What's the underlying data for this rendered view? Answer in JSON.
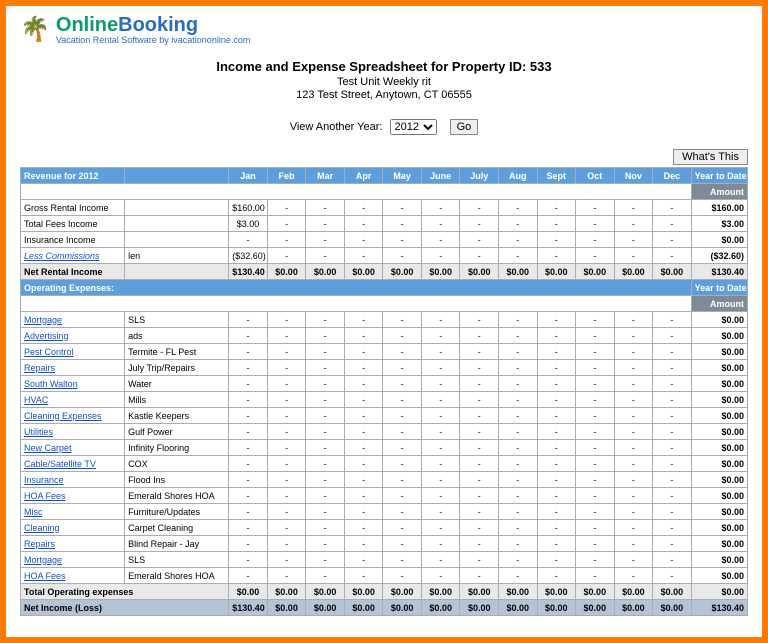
{
  "logo": {
    "online": "Online",
    "booking": "Booking",
    "tagline": "Vacation Rental Software by ivacationonline.com"
  },
  "title": {
    "main": "Income and Expense Spreadsheet for Property ID: 533",
    "unit": "Test Unit Weekly rit",
    "addr": "123 Test Street, Anytown, CT 06555"
  },
  "yearRow": {
    "label": "View Another Year:",
    "selected": "2012",
    "go": "Go"
  },
  "whatsThis": "What's This",
  "months": [
    "Jan",
    "Feb",
    "Mar",
    "Apr",
    "May",
    "June",
    "July",
    "Aug",
    "Sept",
    "Oct",
    "Nov",
    "Dec"
  ],
  "revHdr": "Revenue for 2012",
  "ytdHdr": "Year to Date",
  "amountHdr": "Amount",
  "revenue": [
    {
      "label": "Gross Rental Income",
      "sub": "",
      "vals": [
        "$160.00",
        "-",
        "-",
        "-",
        "-",
        "-",
        "-",
        "-",
        "-",
        "-",
        "-",
        "-"
      ],
      "ytd": "$160.00"
    },
    {
      "label": "Total Fees Income",
      "sub": "",
      "vals": [
        "$3.00",
        "-",
        "-",
        "-",
        "-",
        "-",
        "-",
        "-",
        "-",
        "-",
        "-",
        "-"
      ],
      "ytd": "$3.00"
    },
    {
      "label": "Insurance Income",
      "sub": "",
      "vals": [
        "-",
        "-",
        "-",
        "-",
        "-",
        "-",
        "-",
        "-",
        "-",
        "-",
        "-",
        "-"
      ],
      "ytd": "$0.00"
    },
    {
      "label": "Less Commissions",
      "sub": "len",
      "italic": true,
      "vals": [
        "($32.60)",
        "-",
        "-",
        "-",
        "-",
        "-",
        "-",
        "-",
        "-",
        "-",
        "-",
        "-"
      ],
      "ytd": "($32.60)"
    },
    {
      "label": "Net Rental Income",
      "sub": "",
      "total": true,
      "vals": [
        "$130.40",
        "$0.00",
        "$0.00",
        "$0.00",
        "$0.00",
        "$0.00",
        "$0.00",
        "$0.00",
        "$0.00",
        "$0.00",
        "$0.00",
        "$0.00"
      ],
      "ytd": "$130.40"
    }
  ],
  "opHdr": "Operating Expenses:",
  "expenses": [
    {
      "label": "Mortgage",
      "sub": "SLS",
      "vals": [
        "-",
        "-",
        "-",
        "-",
        "-",
        "-",
        "-",
        "-",
        "-",
        "-",
        "-",
        "-"
      ],
      "ytd": "$0.00"
    },
    {
      "label": "Advertising",
      "sub": "ads",
      "vals": [
        "-",
        "-",
        "-",
        "-",
        "-",
        "-",
        "-",
        "-",
        "-",
        "-",
        "-",
        "-"
      ],
      "ytd": "$0.00"
    },
    {
      "label": "Pest Control",
      "sub": "Termite - FL Pest",
      "vals": [
        "-",
        "-",
        "-",
        "-",
        "-",
        "-",
        "-",
        "-",
        "-",
        "-",
        "-",
        "-"
      ],
      "ytd": "$0.00"
    },
    {
      "label": "Repairs",
      "sub": "July Trip/Repairs",
      "vals": [
        "-",
        "-",
        "-",
        "-",
        "-",
        "-",
        "-",
        "-",
        "-",
        "-",
        "-",
        "-"
      ],
      "ytd": "$0.00"
    },
    {
      "label": "South Walton",
      "sub": "Water",
      "vals": [
        "-",
        "-",
        "-",
        "-",
        "-",
        "-",
        "-",
        "-",
        "-",
        "-",
        "-",
        "-"
      ],
      "ytd": "$0.00"
    },
    {
      "label": "HVAC",
      "sub": "Mills",
      "vals": [
        "-",
        "-",
        "-",
        "-",
        "-",
        "-",
        "-",
        "-",
        "-",
        "-",
        "-",
        "-"
      ],
      "ytd": "$0.00"
    },
    {
      "label": "Cleaning Expenses",
      "sub": "Kastle Keepers",
      "vals": [
        "-",
        "-",
        "-",
        "-",
        "-",
        "-",
        "-",
        "-",
        "-",
        "-",
        "-",
        "-"
      ],
      "ytd": "$0.00"
    },
    {
      "label": "Utilities",
      "sub": "Gulf Power",
      "vals": [
        "-",
        "-",
        "-",
        "-",
        "-",
        "-",
        "-",
        "-",
        "-",
        "-",
        "-",
        "-"
      ],
      "ytd": "$0.00"
    },
    {
      "label": "New Carpet",
      "sub": "Infinity Flooring",
      "vals": [
        "-",
        "-",
        "-",
        "-",
        "-",
        "-",
        "-",
        "-",
        "-",
        "-",
        "-",
        "-"
      ],
      "ytd": "$0.00"
    },
    {
      "label": "Cable/Satellite TV",
      "sub": "COX",
      "vals": [
        "-",
        "-",
        "-",
        "-",
        "-",
        "-",
        "-",
        "-",
        "-",
        "-",
        "-",
        "-"
      ],
      "ytd": "$0.00"
    },
    {
      "label": "Insurance",
      "sub": "Flood Ins",
      "vals": [
        "-",
        "-",
        "-",
        "-",
        "-",
        "-",
        "-",
        "-",
        "-",
        "-",
        "-",
        "-"
      ],
      "ytd": "$0.00"
    },
    {
      "label": "HOA Fees",
      "sub": "Emerald Shores HOA",
      "vals": [
        "-",
        "-",
        "-",
        "-",
        "-",
        "-",
        "-",
        "-",
        "-",
        "-",
        "-",
        "-"
      ],
      "ytd": "$0.00"
    },
    {
      "label": "Misc",
      "sub": "Furniture/Updates",
      "vals": [
        "-",
        "-",
        "-",
        "-",
        "-",
        "-",
        "-",
        "-",
        "-",
        "-",
        "-",
        "-"
      ],
      "ytd": "$0.00"
    },
    {
      "label": "Cleaning",
      "sub": "Carpet Cleaning",
      "vals": [
        "-",
        "-",
        "-",
        "-",
        "-",
        "-",
        "-",
        "-",
        "-",
        "-",
        "-",
        "-"
      ],
      "ytd": "$0.00"
    },
    {
      "label": "Repairs",
      "sub": "Blind Repair - Jay",
      "vals": [
        "-",
        "-",
        "-",
        "-",
        "-",
        "-",
        "-",
        "-",
        "-",
        "-",
        "-",
        "-"
      ],
      "ytd": "$0.00"
    },
    {
      "label": "Mortgage",
      "sub": "SLS",
      "vals": [
        "-",
        "-",
        "-",
        "-",
        "-",
        "-",
        "-",
        "-",
        "-",
        "-",
        "-",
        "-"
      ],
      "ytd": "$0.00"
    },
    {
      "label": "HOA Fees",
      "sub": "Emerald Shores HOA",
      "vals": [
        "-",
        "-",
        "-",
        "-",
        "-",
        "-",
        "-",
        "-",
        "-",
        "-",
        "-",
        "-"
      ],
      "ytd": "$0.00"
    }
  ],
  "totalOp": {
    "label": "Total Operating expenses",
    "vals": [
      "$0.00",
      "$0.00",
      "$0.00",
      "$0.00",
      "$0.00",
      "$0.00",
      "$0.00",
      "$0.00",
      "$0.00",
      "$0.00",
      "$0.00",
      "$0.00"
    ],
    "ytd": "$0.00"
  },
  "netIncome": {
    "label": "Net Income (Loss)",
    "vals": [
      "$130.40",
      "$0.00",
      "$0.00",
      "$0.00",
      "$0.00",
      "$0.00",
      "$0.00",
      "$0.00",
      "$0.00",
      "$0.00",
      "$0.00",
      "$0.00"
    ],
    "ytd": "$130.40"
  }
}
